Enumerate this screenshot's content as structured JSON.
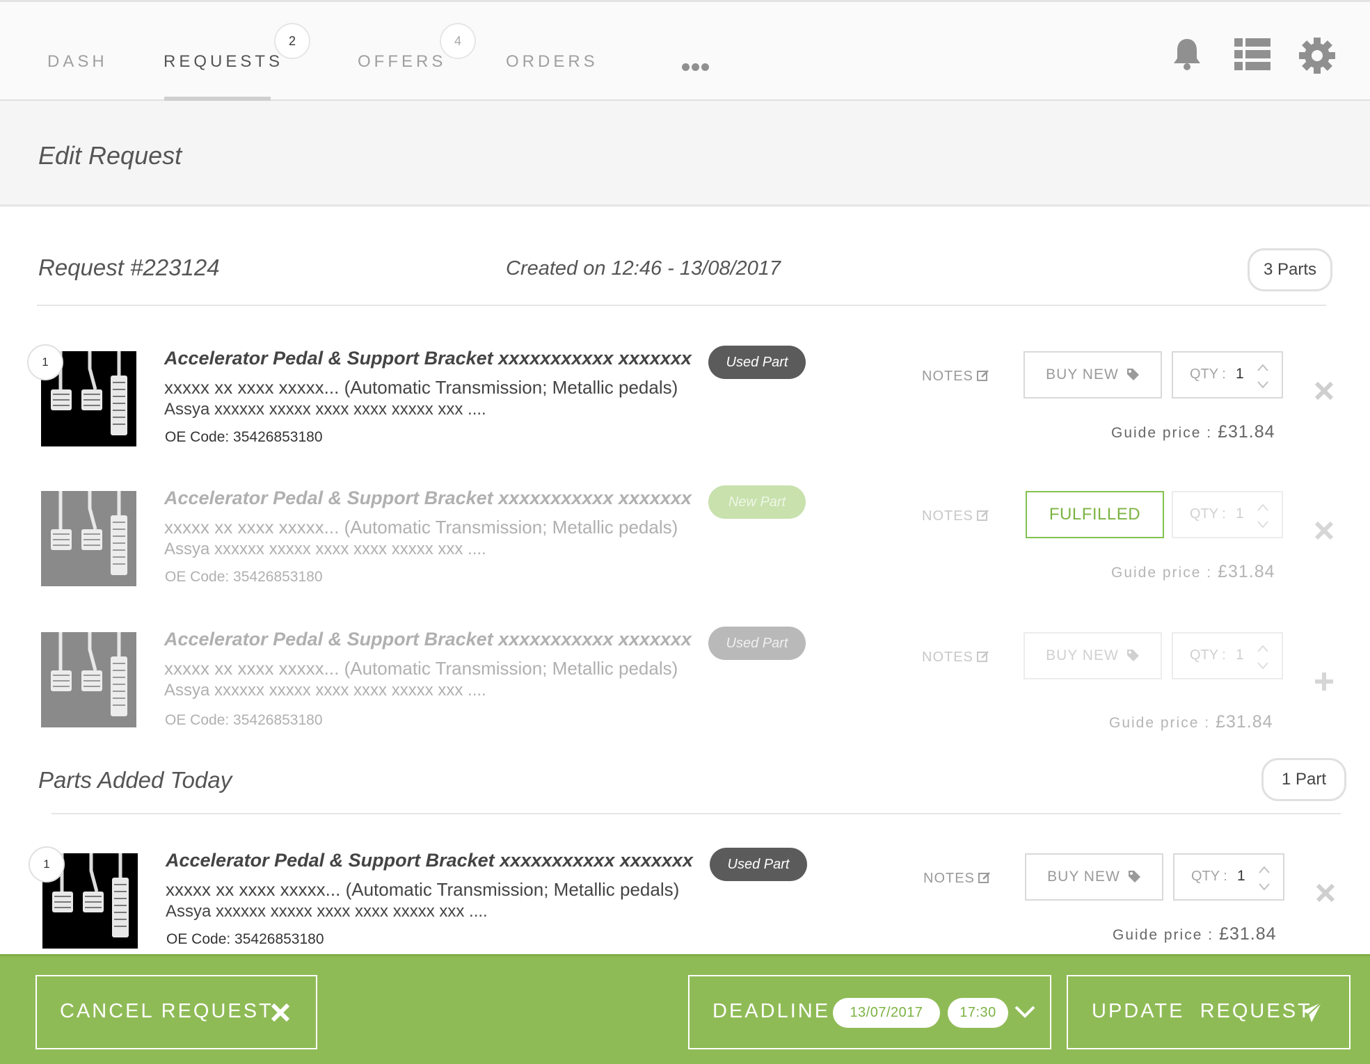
{
  "nav": {
    "tabs": [
      {
        "label": "DASH"
      },
      {
        "label": "REQUESTS",
        "badge": "2"
      },
      {
        "label": "OFFERS",
        "badge": "4"
      },
      {
        "label": "ORDERS"
      }
    ],
    "active_tab": "REQUESTS",
    "more_icon": "ellipsis-icon",
    "icons": [
      "bell-icon",
      "list-icon",
      "gear-icon"
    ]
  },
  "page": {
    "title": "Edit Request"
  },
  "request": {
    "number": "Request #223124",
    "created": "Created on 12:46 - 13/08/2017",
    "parts_count": "3 Parts",
    "parts": [
      {
        "index": "1",
        "name": "Accelerator Pedal & Support Bracket xxxxxxxxxxx xxxxxxx",
        "desc1": "xxxxx xx xxxx xxxxx... (Automatic Transmission; Metallic pedals)",
        "desc2": "Assya xxxxxx xxxxx xxxx xxxx xxxxx xxx ....",
        "oe_code": "OE Code: 35426853180",
        "condition": "Used Part",
        "notes": "NOTES",
        "action": "BUY NEW",
        "qty_label": "QTY :",
        "qty": "1",
        "guide_label": "Guide price :",
        "guide_price": "£31.84",
        "row_action_icon": "close-icon"
      },
      {
        "name": "Accelerator Pedal & Support Bracket xxxxxxxxxxx xxxxxxx",
        "desc1": "xxxxx xx xxxx xxxxx... (Automatic Transmission; Metallic pedals)",
        "desc2": "Assya xxxxxx xxxxx xxxx xxxx xxxxx xxx ....",
        "oe_code": "OE Code: 35426853180",
        "condition": "New Part",
        "notes": "NOTES",
        "action": "FULFILLED",
        "qty_label": "QTY :",
        "qty": "1",
        "guide_label": "Guide price :",
        "guide_price": "£31.84",
        "row_action_icon": "close-icon"
      },
      {
        "name": "Accelerator Pedal & Support Bracket xxxxxxxxxxx xxxxxxx",
        "desc1": "xxxxx xx xxxx xxxxx... (Automatic Transmission; Metallic pedals)",
        "desc2": "Assya xxxxxx xxxxx xxxx xxxx xxxxx xxx ....",
        "oe_code": "OE Code: 35426853180",
        "condition": "Used Part",
        "notes": "NOTES",
        "action": "BUY NEW",
        "qty_label": "QTY :",
        "qty": "1",
        "guide_label": "Guide price :",
        "guide_price": "£31.84",
        "row_action_icon": "plus-icon"
      }
    ]
  },
  "added_today": {
    "title": "Parts Added Today",
    "count": "1 Part",
    "parts": [
      {
        "index": "1",
        "name": "Accelerator Pedal & Support Bracket xxxxxxxxxxx xxxxxxx",
        "desc1": "xxxxx xx xxxx xxxxx... (Automatic Transmission; Metallic pedals)",
        "desc2": "Assya xxxxxx xxxxx xxxx xxxx xxxxx xxx ....",
        "oe_code": "OE Code: 35426853180",
        "condition": "Used Part",
        "notes": "NOTES",
        "action": "BUY NEW",
        "qty_label": "QTY :",
        "qty": "1",
        "guide_label": "Guide price :",
        "guide_price": "£31.84",
        "row_action_icon": "close-icon"
      }
    ]
  },
  "footer": {
    "cancel_label": "CANCEL REQUEST",
    "deadline_label": "DEADLINE",
    "deadline_date": "13/07/2017",
    "deadline_time": "17:30",
    "update_label": "UPDATE  REQUEST"
  },
  "colors": {
    "footer_bg": "#8fbb56",
    "accent_green": "#7cb342",
    "badge_dark": "#5b5b5b",
    "badge_new": "#c8e1ad"
  }
}
